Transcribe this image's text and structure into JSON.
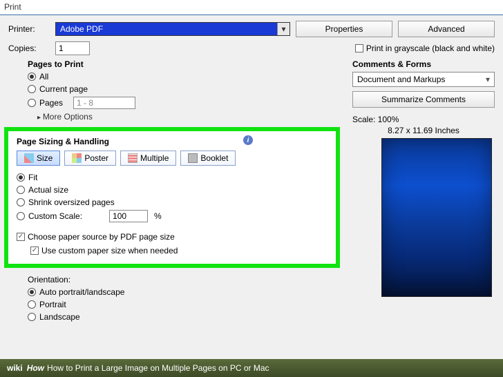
{
  "window": {
    "title": "Print"
  },
  "header": {
    "printer_label": "Printer:",
    "printer_value": "Adobe PDF",
    "copies_label": "Copies:",
    "copies_value": "1",
    "properties_btn": "Properties",
    "advanced_btn": "Advanced",
    "grayscale_label": "Print in grayscale (black and white)"
  },
  "pages_to_print": {
    "title": "Pages to Print",
    "all": "All",
    "current": "Current page",
    "pages": "Pages",
    "pages_value": "1 - 8",
    "more_options": "More Options"
  },
  "sizing": {
    "title": "Page Sizing & Handling",
    "size": "Size",
    "poster": "Poster",
    "multiple": "Multiple",
    "booklet": "Booklet",
    "fit": "Fit",
    "actual_size": "Actual size",
    "shrink": "Shrink oversized pages",
    "custom_scale": "Custom Scale:",
    "custom_scale_value": "100",
    "percent": "%",
    "choose_paper": "Choose paper source by PDF page size",
    "use_custom_paper": "Use custom paper size when needed"
  },
  "orientation": {
    "title": "Orientation:",
    "auto": "Auto portrait/landscape",
    "portrait": "Portrait",
    "landscape": "Landscape"
  },
  "comments": {
    "title": "Comments & Forms",
    "value": "Document and Markups",
    "summarize_btn": "Summarize Comments"
  },
  "preview": {
    "scale": "Scale: 100%",
    "dims": "8.27 x 11.69 Inches"
  },
  "footer": {
    "wiki": "wiki",
    "how": "How",
    "text": "How to Print a Large Image on Multiple Pages on PC or Mac"
  }
}
